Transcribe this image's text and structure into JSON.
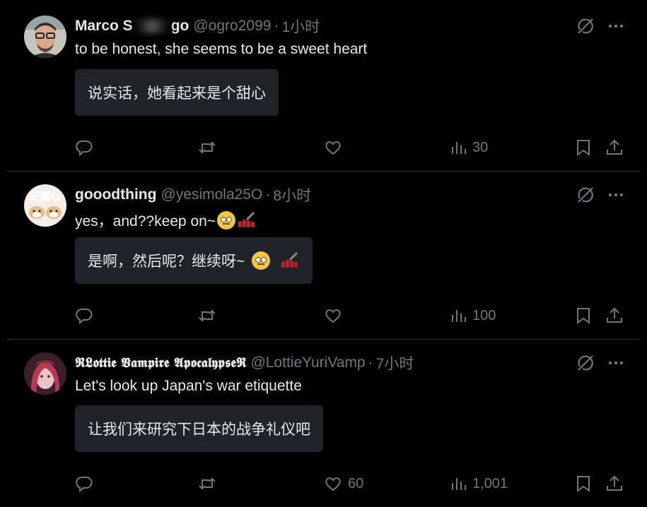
{
  "tweets": [
    {
      "name_pre": "Marco S",
      "name_post": "go",
      "handle": "@ogro2099",
      "sep": "·",
      "time": "1小时",
      "text": "to be honest, she seems to be a sweet heart",
      "translation": "说实话，她看起来是个甜心",
      "likes": "",
      "views": "30"
    },
    {
      "name": "gooodthing",
      "handle": "@yesimola25O",
      "sep": "·",
      "time": "8小时",
      "text": "yes，and??keep on~",
      "translation": "是啊，然后呢？继续呀~",
      "likes": "",
      "views": "100",
      "avatar_text": "好開心"
    },
    {
      "name": "𝕽𝕷𝖔𝖙𝖙𝖎𝖊 𝖁𝖆𝖒𝖕𝖎𝖗𝖊 𝕬𝖕𝖔𝖈𝖆𝖑𝖞𝖕𝖘𝖊𝕽",
      "handle": "@LottieYuriVamp",
      "sep": "·",
      "time": "7小时",
      "text": "Let's look up Japan's war etiquette",
      "translation": "让我们来研究下日本的战争礼仪吧",
      "likes": "60",
      "views": "1,001"
    }
  ],
  "icons": {
    "reply": "reply-icon",
    "retweet": "retweet-icon",
    "like": "heart-icon",
    "views": "views-chart-icon",
    "bookmark": "bookmark-icon",
    "share": "share-icon",
    "grok": "grok-icon",
    "more": "more-icon"
  },
  "colors": {
    "background": "#000000",
    "text": "#e7e9ea",
    "muted": "#71767b",
    "divider": "#2f3336",
    "translation_bg": "#202327"
  }
}
